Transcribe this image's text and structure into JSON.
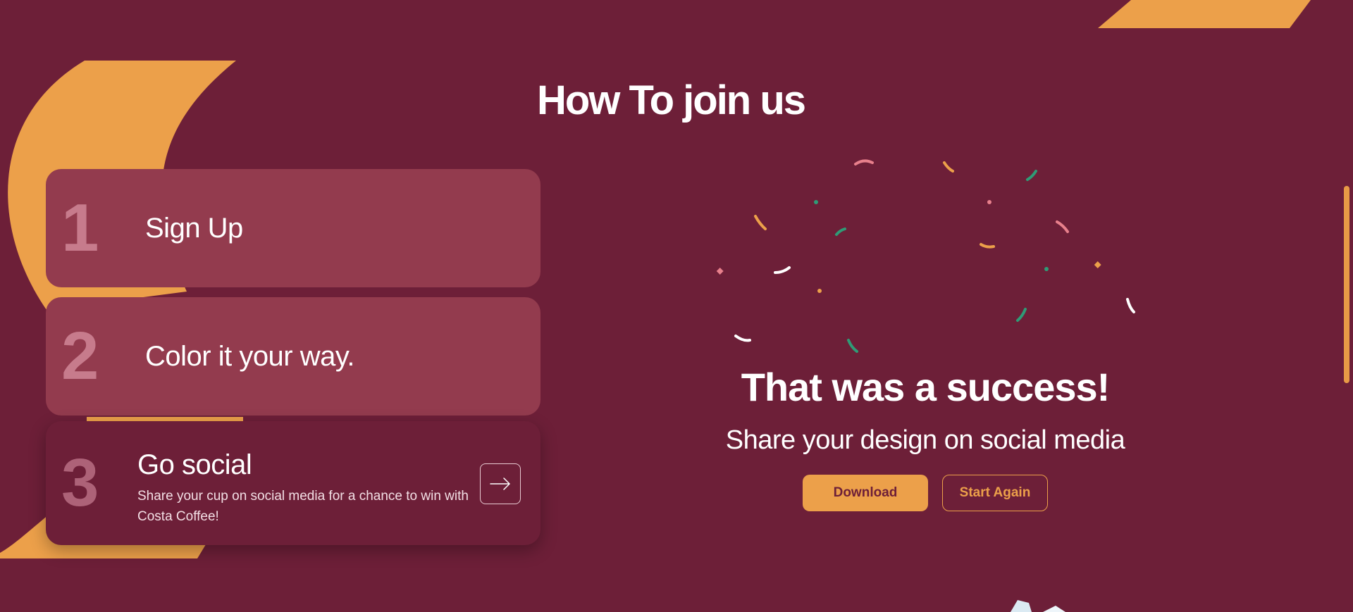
{
  "section": {
    "title": "How To join us"
  },
  "steps": [
    {
      "number": "1",
      "label": "Sign Up"
    },
    {
      "number": "2",
      "label": "Color it your way."
    },
    {
      "number": "3",
      "label": "Go social",
      "description": "Share your cup on social media for a chance to win with Costa Coffee!"
    }
  ],
  "success": {
    "title": "That was a success!",
    "subtitle": "Share your design on social media",
    "download_label": "Download",
    "start_again_label": "Start Again"
  },
  "icons": {
    "step3_action": "arrow-right-icon"
  },
  "colors": {
    "background": "#6d1f38",
    "card": "#933b4e",
    "accent": "#eca04a",
    "confetti": [
      "#e8808c",
      "#eca04a",
      "#2f9b76",
      "#ffffff"
    ]
  }
}
